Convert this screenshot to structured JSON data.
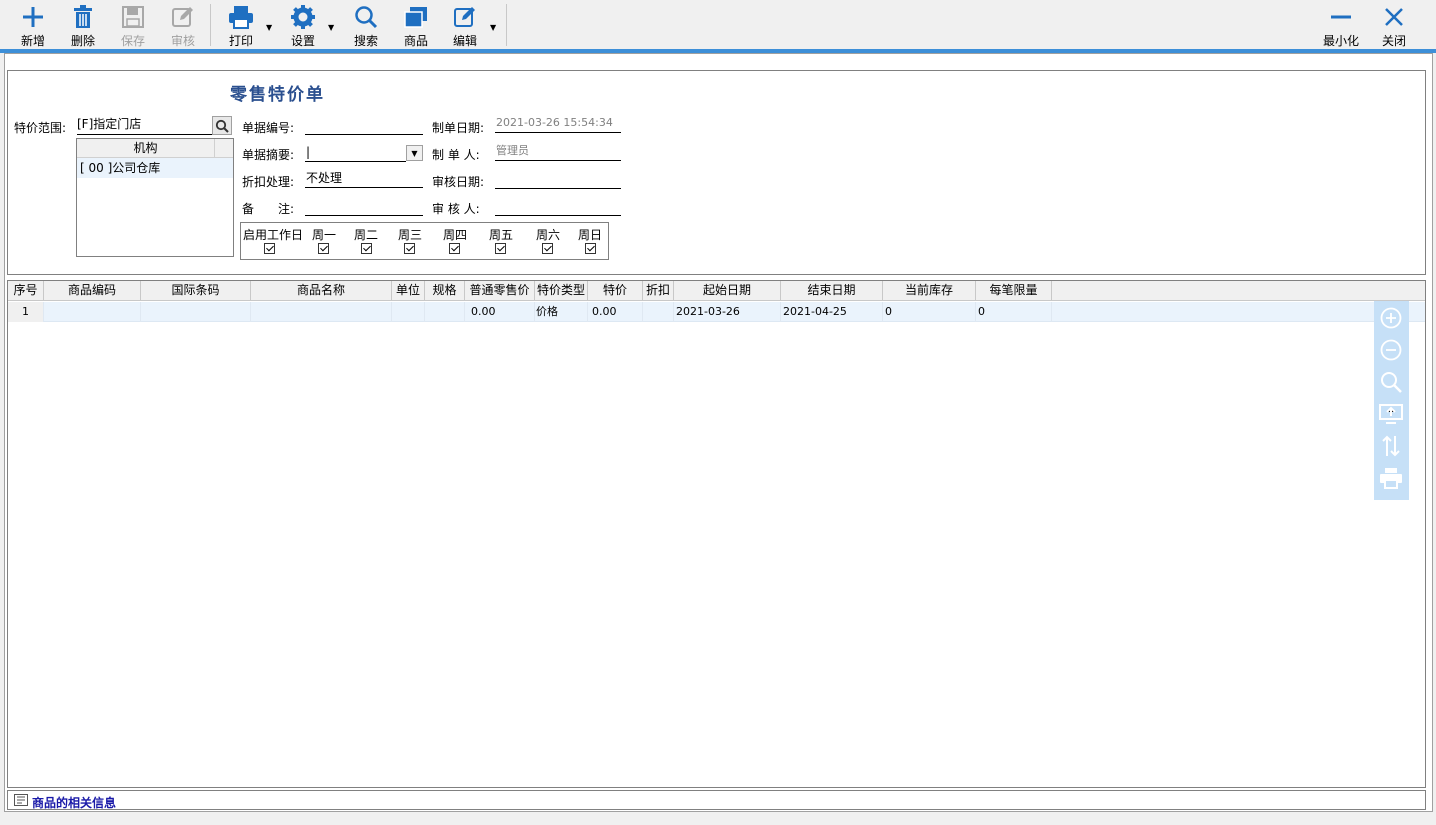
{
  "toolbar": {
    "new": "新增",
    "delete": "删除",
    "save": "保存",
    "audit": "审核",
    "print": "打印",
    "settings": "设置",
    "search": "搜索",
    "goods": "商品",
    "edit": "编辑",
    "minimize": "最小化",
    "close": "关闭"
  },
  "colors": {
    "accent": "#3d8fd8",
    "icon": "#1f6fc1",
    "title": "#2a4f8f",
    "row_highlight": "#eaf3fc",
    "side_panel": "#c6e0f7"
  },
  "form": {
    "title": "零售特价单",
    "scope_label": "特价范围:",
    "scope_value": "[F]指定门店",
    "org_header": "机构",
    "org_rows": [
      "[ 00 ]公司仓库"
    ],
    "doc_no_label": "单据编号:",
    "doc_no_value": "",
    "summary_label": "单据摘要:",
    "summary_value": "|",
    "discount_label": "折扣处理:",
    "discount_value": "不处理",
    "remark_label": "备　　注:",
    "remark_value": "",
    "created_date_label": "制单日期:",
    "created_date_value": "2021-03-26 15:54:34",
    "creator_label": "制 单 人:",
    "creator_value": "管理员",
    "audit_date_label": "审核日期:",
    "audit_date_value": "",
    "auditor_label": "审 核 人:",
    "auditor_value": "",
    "weekdays": [
      "启用工作日",
      "周一",
      "周二",
      "周三",
      "周四",
      "周五",
      "周六",
      "周日"
    ]
  },
  "grid": {
    "columns": [
      "序号",
      "商品编码",
      "国际条码",
      "商品名称",
      "单位",
      "规格",
      "普通零售价",
      "特价类型",
      "特价",
      "折扣",
      "起始日期",
      "结束日期",
      "当前库存",
      "每笔限量"
    ],
    "rows": [
      {
        "no": "1",
        "code": "",
        "barcode": "",
        "name": "",
        "unit": "",
        "spec": "",
        "retail": "0.00",
        "type": "价格",
        "price": "0.00",
        "discount": "",
        "start": "2021-03-26",
        "end": "2021-04-25",
        "stock": "0",
        "limit": "0"
      }
    ]
  },
  "side_tools": [
    "add-circle-icon",
    "remove-circle-icon",
    "search-icon",
    "screen-icon",
    "sort-icon",
    "print-icon"
  ],
  "footer": {
    "label": "商品的相关信息"
  }
}
